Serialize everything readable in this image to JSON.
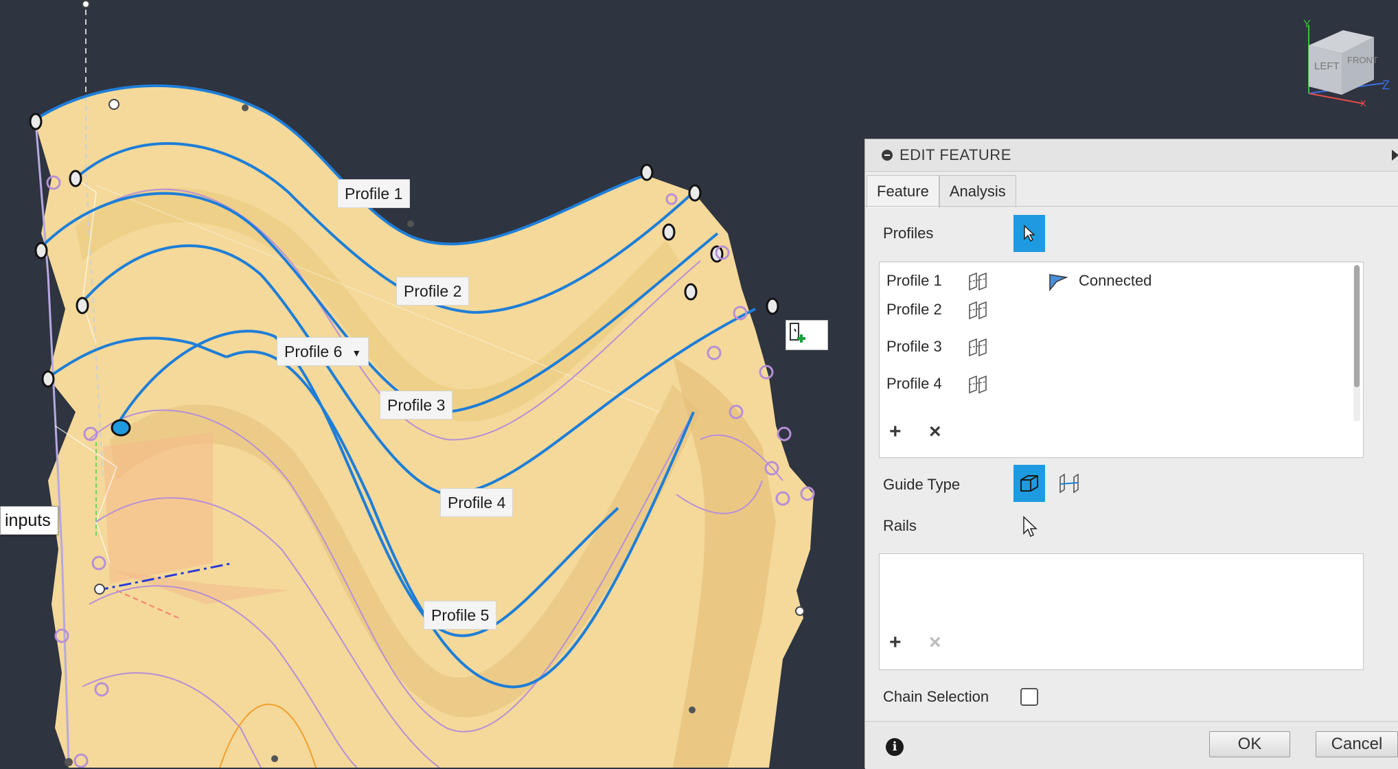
{
  "viewport": {
    "labels": [
      {
        "text": "Profile 1"
      },
      {
        "text": "Profile 2"
      },
      {
        "text": "Profile 6"
      },
      {
        "text": "Profile 3"
      },
      {
        "text": "Profile 4"
      },
      {
        "text": "Profile 5"
      }
    ],
    "inputs_tooltip": "inputs",
    "viewcube": {
      "left": "LEFT",
      "front": "FRONT",
      "axis_y": "Y",
      "axis_z": "Z",
      "axis_x": "X"
    },
    "colors": {
      "background": "#2e3440",
      "surface": "#f7dea0",
      "profile_curve": "#1e7ed8",
      "guide_curve": "#b78fd6"
    }
  },
  "panel": {
    "title": "EDIT FEATURE",
    "tabs": [
      {
        "label": "Feature"
      },
      {
        "label": "Analysis"
      }
    ],
    "profiles_label": "Profiles",
    "profiles": [
      {
        "name": "Profile 1",
        "status": "Connected"
      },
      {
        "name": "Profile 2",
        "status": ""
      },
      {
        "name": "Profile 3",
        "status": ""
      },
      {
        "name": "Profile 4",
        "status": ""
      }
    ],
    "list_add": "+",
    "list_remove": "×",
    "guide_type_label": "Guide Type",
    "rails_label": "Rails",
    "chain_selection_label": "Chain Selection",
    "chain_selection_checked": false,
    "info_icon": "i",
    "ok_label": "OK",
    "cancel_label": "Cancel",
    "accent": "#1e9be0"
  }
}
